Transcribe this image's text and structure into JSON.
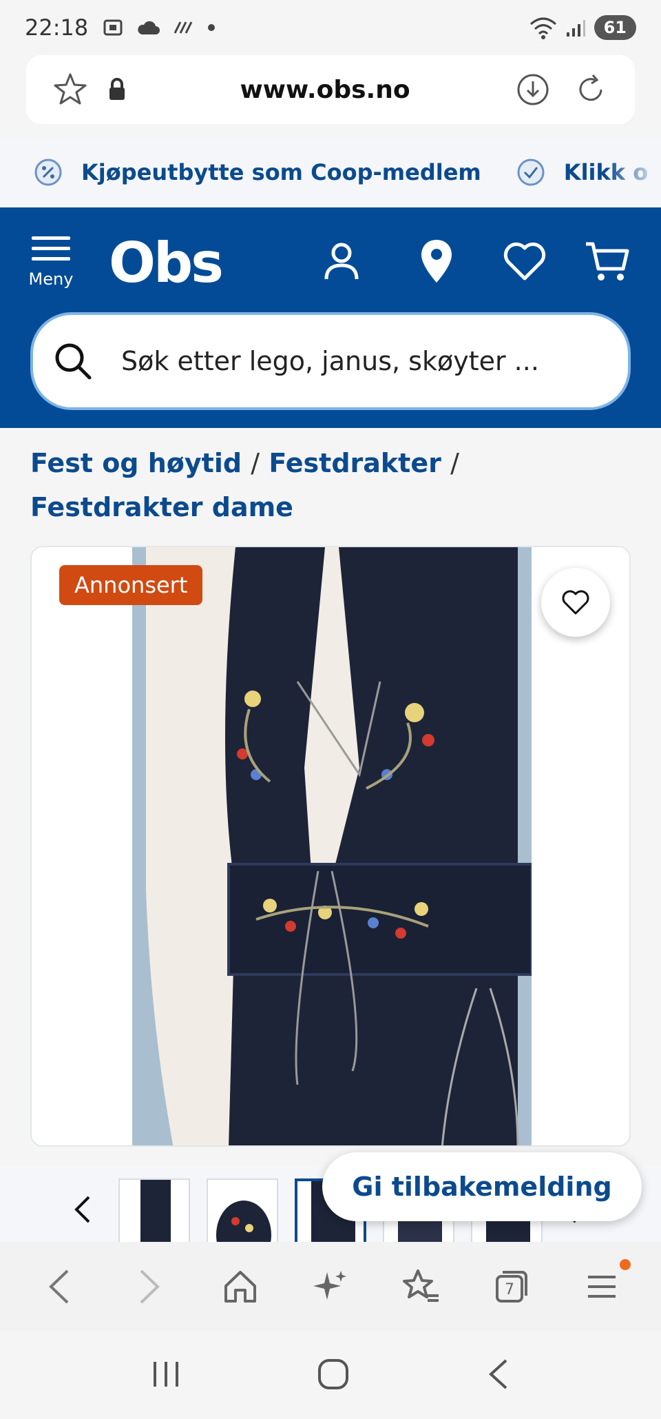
{
  "status": {
    "time": "22:18",
    "battery": "61"
  },
  "browser": {
    "url": "www.obs.no"
  },
  "promo": {
    "items": [
      "Kjøpeutbytte som Coop-medlem",
      "Klikk o"
    ]
  },
  "header": {
    "menu_label": "Meny",
    "logo": "Obs",
    "search_placeholder": "Søk etter lego, janus, skøyter ..."
  },
  "breadcrumb": {
    "items": [
      "Fest og høytid",
      "Festdrakter",
      "Festdrakter dame"
    ],
    "separator": "/"
  },
  "product": {
    "badge": "Annonsert"
  },
  "feedback": {
    "label": "Gi tilbakemelding"
  },
  "browser_nav": {
    "tab_count": "7"
  },
  "colors": {
    "brand_blue": "#044b97",
    "link_blue": "#0c4a8e",
    "badge_orange": "#d14a12"
  }
}
